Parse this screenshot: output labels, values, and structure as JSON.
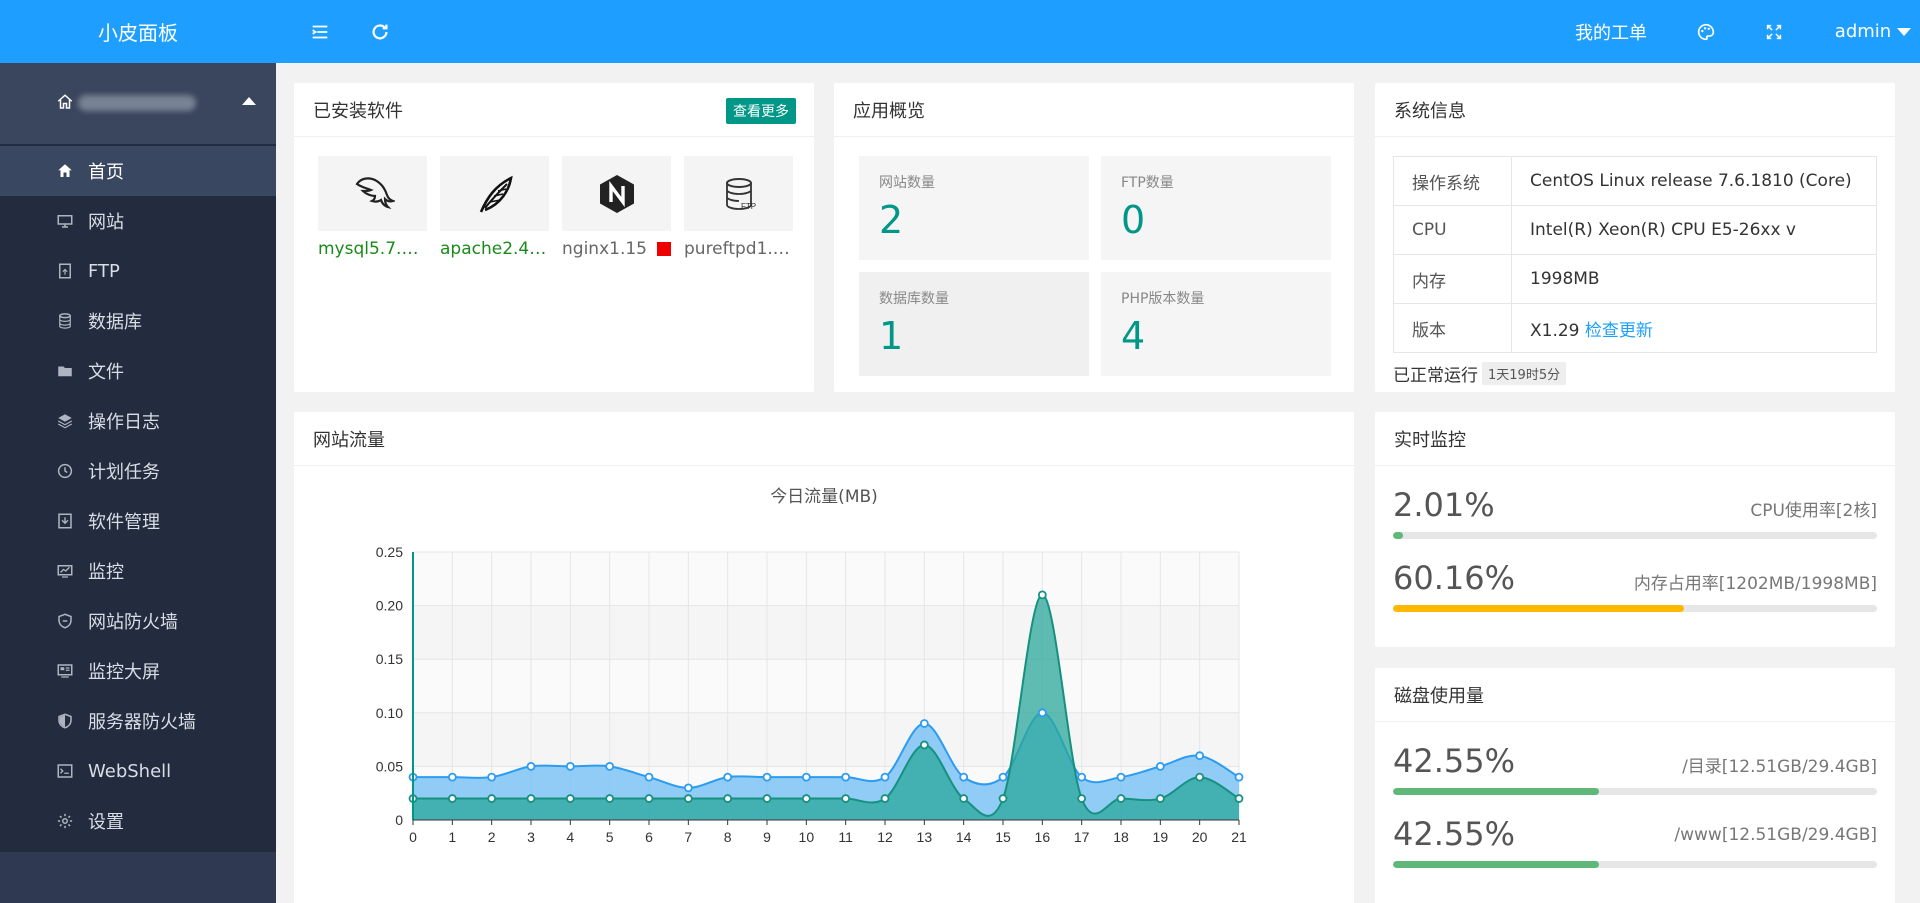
{
  "app": {
    "logo": "小皮面板"
  },
  "sidebar": {
    "items": [
      {
        "label": "首页",
        "icon": "home-icon",
        "active": true
      },
      {
        "label": "网站",
        "icon": "monitor-icon"
      },
      {
        "label": "FTP",
        "icon": "ftp-icon"
      },
      {
        "label": "数据库",
        "icon": "database-icon"
      },
      {
        "label": "文件",
        "icon": "folder-icon"
      },
      {
        "label": "操作日志",
        "icon": "layers-icon"
      },
      {
        "label": "计划任务",
        "icon": "clock-icon"
      },
      {
        "label": "软件管理",
        "icon": "download-icon"
      },
      {
        "label": "监控",
        "icon": "chart-icon"
      },
      {
        "label": "网站防火墙",
        "icon": "shield-icon"
      },
      {
        "label": "监控大屏",
        "icon": "screen-icon"
      },
      {
        "label": "服务器防火墙",
        "icon": "shield-half-icon"
      },
      {
        "label": "WebShell",
        "icon": "terminal-icon"
      },
      {
        "label": "设置",
        "icon": "gear-icon"
      }
    ]
  },
  "header": {
    "tickets": "我的工单",
    "user": "admin"
  },
  "installed": {
    "title": "已安装软件",
    "more": "查看更多",
    "items": [
      {
        "name": "mysql5.7.2…",
        "icon": "dolphin-icon",
        "status": "running"
      },
      {
        "name": "apache2.4.…",
        "icon": "feather-icon",
        "status": "running"
      },
      {
        "name": "nginx1.15",
        "icon": "nginx-icon",
        "status": "stopped"
      },
      {
        "name": "pureftpd1.0…",
        "icon": "ftp-db-icon",
        "status": "other"
      }
    ]
  },
  "overview": {
    "title": "应用概览",
    "tiles": [
      {
        "label": "网站数量",
        "value": "2"
      },
      {
        "label": "FTP数量",
        "value": "0"
      },
      {
        "label": "数据库数量",
        "value": "1"
      },
      {
        "label": "PHP版本数量",
        "value": "4"
      }
    ]
  },
  "sysinfo": {
    "title": "系统信息",
    "rows": [
      {
        "k": "操作系统",
        "v": "CentOS Linux release 7.6.1810 (Core)"
      },
      {
        "k": "CPU",
        "v": "Intel(R) Xeon(R) CPU E5-26xx v"
      },
      {
        "k": "内存",
        "v": "1998MB"
      },
      {
        "k": "版本",
        "v": "X1.29",
        "link": "检查更新"
      }
    ],
    "uptime_label": "已正常运行",
    "uptime_value": "1天19时5分"
  },
  "traffic": {
    "title": "网站流量"
  },
  "realtime": {
    "title": "实时监控",
    "rows": [
      {
        "value": "2.01%",
        "label": "CPU使用率[2核]",
        "pct": 2.01,
        "color": "#5fb878"
      },
      {
        "value": "60.16%",
        "label": "内存占用率[1202MB/1998MB]",
        "pct": 60.16,
        "color": "#ffb800"
      }
    ]
  },
  "disk": {
    "title": "磁盘使用量",
    "rows": [
      {
        "value": "42.55%",
        "label": "/目录[12.51GB/29.4GB]",
        "pct": 42.55,
        "color": "#5fb878"
      },
      {
        "value": "42.55%",
        "label": "/www[12.51GB/29.4GB]",
        "pct": 42.55,
        "color": "#5fb878"
      }
    ]
  },
  "chart_data": {
    "type": "area",
    "title": "今日流量(MB)",
    "x": [
      0,
      1,
      2,
      3,
      4,
      5,
      6,
      7,
      8,
      9,
      10,
      11,
      12,
      13,
      14,
      15,
      16,
      17,
      18,
      19,
      20,
      21
    ],
    "ylim": [
      0,
      0.25
    ],
    "yticks": [
      "0",
      "0.05",
      "0.10",
      "0.15",
      "0.20",
      "0.25"
    ],
    "grid": true,
    "series": [
      {
        "values": [
          0.04,
          0.04,
          0.04,
          0.05,
          0.05,
          0.05,
          0.04,
          0.03,
          0.04,
          0.04,
          0.04,
          0.04,
          0.04,
          0.09,
          0.04,
          0.04,
          0.1,
          0.04,
          0.04,
          0.05,
          0.06,
          0.04
        ],
        "color": "#2d9cf0",
        "fill": "#7cc3f5"
      },
      {
        "values": [
          0.02,
          0.02,
          0.02,
          0.02,
          0.02,
          0.02,
          0.02,
          0.02,
          0.02,
          0.02,
          0.02,
          0.02,
          0.02,
          0.07,
          0.02,
          0.02,
          0.21,
          0.02,
          0.02,
          0.02,
          0.04,
          0.02
        ],
        "color": "#16907f",
        "fill": "#2aa79b"
      }
    ]
  }
}
